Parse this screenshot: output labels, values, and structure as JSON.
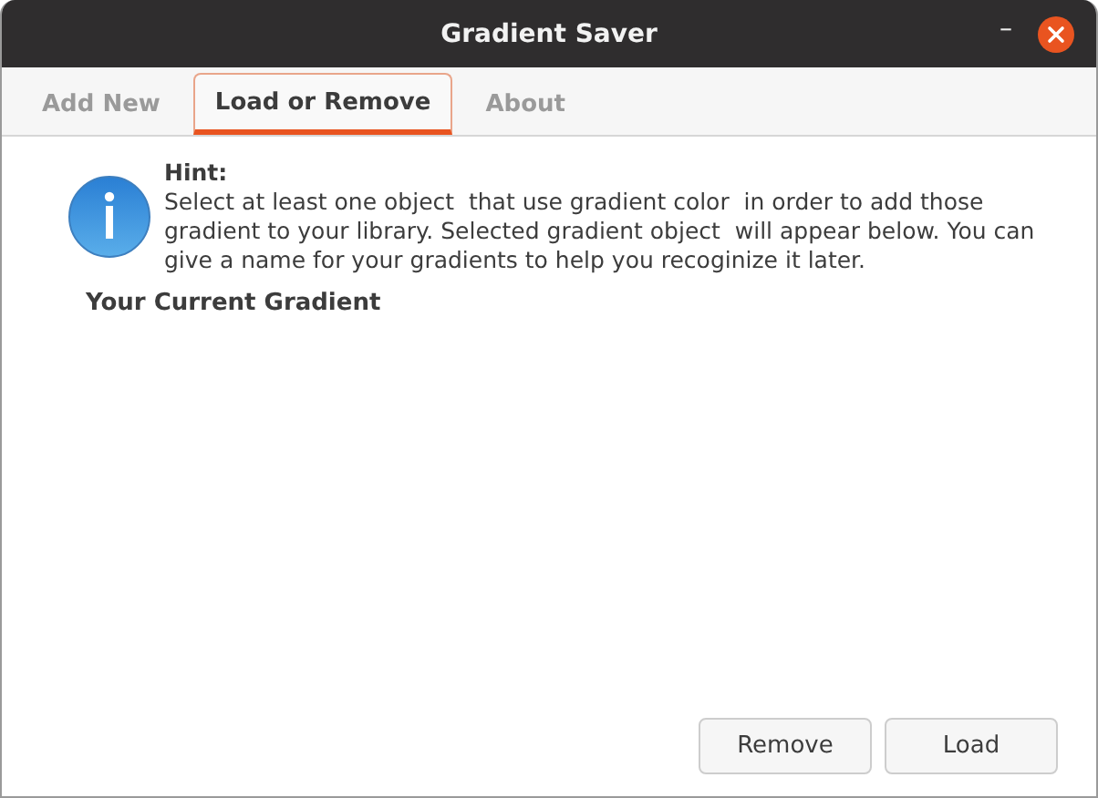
{
  "window": {
    "title": "Gradient Saver",
    "controls": [
      "–"
    ]
  },
  "tabs": [
    {
      "label": "Add New",
      "selected": false
    },
    {
      "label": "Load or Remove",
      "selected": true
    },
    {
      "label": "About",
      "selected": false
    }
  ],
  "hint": {
    "title": "Hint:",
    "text": "Select at least one object  that use gradient color  in order to add those gradient to your library. Selected gradient object  will appear below. You can give a name for your gradients to help you recoginize it later."
  },
  "section_title": "Your Current Gradient",
  "buttons": [
    "Remove",
    "Load"
  ]
}
